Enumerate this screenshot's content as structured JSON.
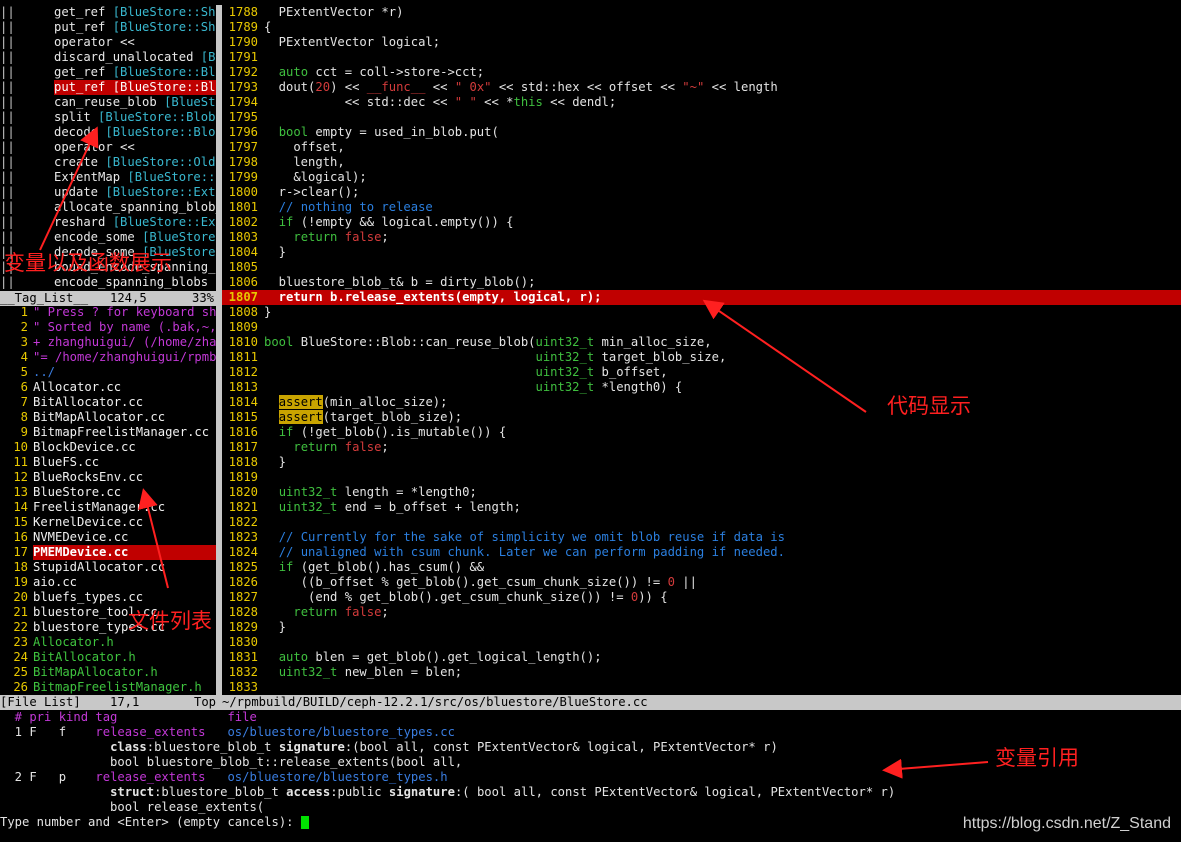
{
  "tag_list": {
    "rows": [
      {
        "name": "get_ref ",
        "scope": "[BlueStore::Sha"
      },
      {
        "name": "put_ref ",
        "scope": "[BlueStore::Sha"
      },
      {
        "name": "operator <<",
        "scope": ""
      },
      {
        "name": "discard_unallocated ",
        "scope": "[Blo"
      },
      {
        "name": "get_ref ",
        "scope": "[BlueStore::Blo"
      },
      {
        "name": "put_ref [BlueStore::Blo",
        "scope": "",
        "selected": true
      },
      {
        "name": "can_reuse_blob ",
        "scope": "[BlueSto"
      },
      {
        "name": "split ",
        "scope": "[BlueStore::Blob]"
      },
      {
        "name": "decode ",
        "scope": "[BlueStore::Blob"
      },
      {
        "name": "operator <<",
        "scope": ""
      },
      {
        "name": "create ",
        "scope": "[BlueStore::OldE"
      },
      {
        "name": "ExtentMap ",
        "scope": "[BlueStore::E"
      },
      {
        "name": "update ",
        "scope": "[BlueStore::Exte"
      },
      {
        "name": "allocate_spanning_blob_",
        "scope": ""
      },
      {
        "name": "reshard ",
        "scope": "[BlueStore::Ext"
      },
      {
        "name": "encode_some ",
        "scope": "[BlueStore:"
      },
      {
        "name": "decode_some ",
        "scope": "[BlueStore:"
      },
      {
        "name": "bound_encode_spanning_b",
        "scope": ""
      },
      {
        "name": "encode_spanning_blobs [",
        "scope": ""
      }
    ],
    "status_left": "__Tag_List__",
    "status_pos": "124,5",
    "status_pct": "33%"
  },
  "file_list": {
    "rows": [
      {
        "n": "1",
        "text": "\" Press ? for keyboard sho",
        "color": "mag"
      },
      {
        "n": "2",
        "text": "\" Sorted by name (.bak,~,.",
        "color": "mag"
      },
      {
        "n": "3",
        "text": "+ zhanghuigui/ (/home/zhan",
        "color": "mag"
      },
      {
        "n": "4",
        "text": "\"= /home/zhanghuigui/rpmbu",
        "color": "mag"
      },
      {
        "n": "5",
        "text": "../",
        "color": "blue"
      },
      {
        "n": "6",
        "text": "Allocator.cc",
        "color": "white"
      },
      {
        "n": "7",
        "text": "BitAllocator.cc",
        "color": "white"
      },
      {
        "n": "8",
        "text": "BitMapAllocator.cc",
        "color": "white"
      },
      {
        "n": "9",
        "text": "BitmapFreelistManager.cc",
        "color": "white"
      },
      {
        "n": "10",
        "text": "BlockDevice.cc",
        "color": "white"
      },
      {
        "n": "11",
        "text": "BlueFS.cc",
        "color": "white"
      },
      {
        "n": "12",
        "text": "BlueRocksEnv.cc",
        "color": "white"
      },
      {
        "n": "13",
        "text": "BlueStore.cc",
        "color": "white"
      },
      {
        "n": "14",
        "text": "FreelistManager.cc",
        "color": "white"
      },
      {
        "n": "15",
        "text": "KernelDevice.cc",
        "color": "white"
      },
      {
        "n": "16",
        "text": "NVMEDevice.cc",
        "color": "white"
      },
      {
        "n": "17",
        "text": "PMEMDevice.cc",
        "color": "sel"
      },
      {
        "n": "18",
        "text": "StupidAllocator.cc",
        "color": "white"
      },
      {
        "n": "19",
        "text": "aio.cc",
        "color": "white"
      },
      {
        "n": "20",
        "text": "bluefs_types.cc",
        "color": "white"
      },
      {
        "n": "21",
        "text": "bluestore_tool.cc",
        "color": "white"
      },
      {
        "n": "22",
        "text": "bluestore_types.cc",
        "color": "white"
      },
      {
        "n": "23",
        "text": "Allocator.h",
        "color": "green"
      },
      {
        "n": "24",
        "text": "BitAllocator.h",
        "color": "green"
      },
      {
        "n": "25",
        "text": "BitMapAllocator.h",
        "color": "green"
      },
      {
        "n": "26",
        "text": "BitmapFreelistManager.h",
        "color": "green"
      }
    ],
    "status_left": "[File List]",
    "status_pos": "17,1",
    "status_top": "Top"
  },
  "code": {
    "lines": [
      {
        "n": "1788",
        "html": "  PExtentVector *r)"
      },
      {
        "n": "1789",
        "html": "{"
      },
      {
        "n": "1790",
        "html": "  PExtentVector logical;"
      },
      {
        "n": "1791",
        "html": ""
      },
      {
        "n": "1792",
        "html": "  <span class='ty'>auto</span> cct = coll-&gt;store-&gt;cct;"
      },
      {
        "n": "1793",
        "html": "  dout(<span class='str'>20</span>) &lt;&lt; <span class='str'>__func__</span> &lt;&lt; <span class='str'>\" 0x\"</span> &lt;&lt; std::hex &lt;&lt; offset &lt;&lt; <span class='str'>\"~\"</span> &lt;&lt; length"
      },
      {
        "n": "1794",
        "html": "           &lt;&lt; std::dec &lt;&lt; <span class='str'>\" \"</span> &lt;&lt; *<span class='kw'>this</span> &lt;&lt; dendl;"
      },
      {
        "n": "1795",
        "html": ""
      },
      {
        "n": "1796",
        "html": "  <span class='ty'>bool</span> empty = used_in_blob.put("
      },
      {
        "n": "1797",
        "html": "    offset,"
      },
      {
        "n": "1798",
        "html": "    length,"
      },
      {
        "n": "1799",
        "html": "    &amp;logical);"
      },
      {
        "n": "1800",
        "html": "  r-&gt;clear();"
      },
      {
        "n": "1801",
        "html": "  <span class='cm'>// nothing to release</span>"
      },
      {
        "n": "1802",
        "html": "  <span class='kw'>if</span> (!empty &amp;&amp; logical.empty()) {"
      },
      {
        "n": "1803",
        "html": "    <span class='kw'>return</span> <span class='str'>false</span>;"
      },
      {
        "n": "1804",
        "html": "  }"
      },
      {
        "n": "1805",
        "html": ""
      },
      {
        "n": "1806",
        "html": "  bluestore_blob_t&amp; b = dirty_blob();"
      },
      {
        "n": "1807",
        "html": "  return b.release_extents(empty, logical, r);",
        "current": true
      },
      {
        "n": "1808",
        "html": "}"
      },
      {
        "n": "1809",
        "html": ""
      },
      {
        "n": "1810",
        "html": "<span class='ty'>bool</span> BlueStore::Blob::can_reuse_blob(<span class='ty'>uint32_t</span> min_alloc_size,"
      },
      {
        "n": "1811",
        "html": "                                     <span class='ty'>uint32_t</span> target_blob_size,"
      },
      {
        "n": "1812",
        "html": "                                     <span class='ty'>uint32_t</span> b_offset,"
      },
      {
        "n": "1813",
        "html": "                                     <span class='ty'>uint32_t</span> *length0) {"
      },
      {
        "n": "1814",
        "html": "  <span class='hl-yellow'>assert</span>(min_alloc_size);"
      },
      {
        "n": "1815",
        "html": "  <span class='hl-yellow'>assert</span>(target_blob_size);"
      },
      {
        "n": "1816",
        "html": "  <span class='kw'>if</span> (!get_blob().is_mutable()) {"
      },
      {
        "n": "1817",
        "html": "    <span class='kw'>return</span> <span class='str'>false</span>;"
      },
      {
        "n": "1818",
        "html": "  }"
      },
      {
        "n": "1819",
        "html": ""
      },
      {
        "n": "1820",
        "html": "  <span class='ty'>uint32_t</span> length = *length0;"
      },
      {
        "n": "1821",
        "html": "  <span class='ty'>uint32_t</span> end = b_offset + length;"
      },
      {
        "n": "1822",
        "html": ""
      },
      {
        "n": "1823",
        "html": "  <span class='cm'>// Currently for the sake of simplicity we omit blob reuse if data is</span>"
      },
      {
        "n": "1824",
        "html": "  <span class='cm'>// unaligned with csum chunk. Later we can perform padding if needed.</span>"
      },
      {
        "n": "1825",
        "html": "  <span class='kw'>if</span> (get_blob().has_csum() &amp;&amp;"
      },
      {
        "n": "1826",
        "html": "     ((b_offset % get_blob().get_csum_chunk_size()) != <span class='str'>0</span> ||"
      },
      {
        "n": "1827",
        "html": "      (end % get_blob().get_csum_chunk_size()) != <span class='str'>0</span>)) {"
      },
      {
        "n": "1828",
        "html": "    <span class='kw'>return</span> <span class='str'>false</span>;"
      },
      {
        "n": "1829",
        "html": "  }"
      },
      {
        "n": "1830",
        "html": ""
      },
      {
        "n": "1831",
        "html": "  <span class='ty'>auto</span> blen = get_blob().get_logical_length();"
      },
      {
        "n": "1832",
        "html": "  <span class='ty'>uint32_t</span> new_blen = blen;"
      },
      {
        "n": "1833",
        "html": ""
      }
    ],
    "status_path": "~/rpmbuild/BUILD/ceph-12.2.1/src/os/bluestore/BlueStore.cc"
  },
  "tselect": {
    "header": "  # pri kind tag               file",
    "r1a_num": "  1 F   f    ",
    "r1a_tag": "release_extents   ",
    "r1a_file": "os/bluestore/bluestore_types.cc",
    "r1b_pre": "               ",
    "r1b_k1": "class",
    "r1b_v1": ":bluestore_blob_t ",
    "r1b_k2": "signature",
    "r1b_v2": ":(bool all, const PExtentVector& logical, PExtentVector* r)",
    "r1c": "               bool bluestore_blob_t::release_extents(bool all,",
    "r2a_num": "  2 F   p    ",
    "r2a_tag": "release_extents   ",
    "r2a_file": "os/bluestore/bluestore_types.h",
    "r2b_pre": "               ",
    "r2b_k1": "struct",
    "r2b_v1": ":bluestore_blob_t ",
    "r2b_k2": "access",
    "r2b_v2": ":public ",
    "r2b_k3": "signature",
    "r2b_v3": ":( bool all, const PExtentVector& logical, PExtentVector* r)",
    "r2c": "               bool release_extents(",
    "prompt": "Type number and <Enter> (empty cancels): "
  },
  "annotations": {
    "tag_label": "变量以及函数展示",
    "code_label": "代码显示",
    "file_label": "文件列表",
    "ref_label": "变量引用"
  },
  "watermark": "https://blog.csdn.net/Z_Stand",
  "colors": {
    "highlight_red": "#c00000",
    "status_bar": "#c8c8c8",
    "annotation": "#ff2020"
  }
}
